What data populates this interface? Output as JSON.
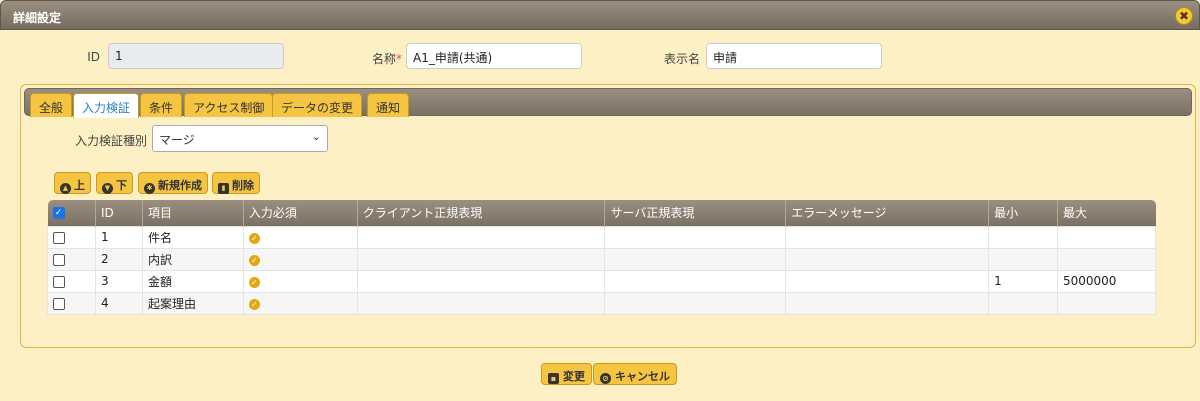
{
  "window": {
    "title": "詳細設定",
    "close_icon": "✖"
  },
  "form": {
    "id_label": "ID",
    "id_value": "1",
    "name_label": "名称",
    "required_mark": "*",
    "name_value": "A1_申請(共通)",
    "display_label": "表示名",
    "display_value": "申請"
  },
  "tabs": [
    {
      "label": "全般"
    },
    {
      "label": "入力検証"
    },
    {
      "label": "条件"
    },
    {
      "label": "アクセス制御"
    },
    {
      "label": "データの変更"
    },
    {
      "label": "通知"
    }
  ],
  "active_tab": "入力検証",
  "validation_type": {
    "label": "入力検証種別",
    "value": "マージ"
  },
  "toolbar": {
    "up_label": "上",
    "down_label": "下",
    "new_label": "新規作成",
    "delete_label": "削除"
  },
  "table": {
    "headers": [
      "",
      "ID",
      "項目",
      "入力必須",
      "クライアント正規表現",
      "サーバ正規表現",
      "エラーメッセージ",
      "最小",
      "最大"
    ],
    "rows": [
      {
        "id": "1",
        "item": "件名",
        "required": true,
        "client_regex": "",
        "server_regex": "",
        "error_message": "",
        "min": "",
        "max": ""
      },
      {
        "id": "2",
        "item": "内訳",
        "required": true,
        "client_regex": "",
        "server_regex": "",
        "error_message": "",
        "min": "",
        "max": ""
      },
      {
        "id": "3",
        "item": "金額",
        "required": true,
        "client_regex": "",
        "server_regex": "",
        "error_message": "",
        "min": "1",
        "max": "5000000"
      },
      {
        "id": "4",
        "item": "起案理由",
        "required": true,
        "client_regex": "",
        "server_regex": "",
        "error_message": "",
        "min": "",
        "max": ""
      }
    ]
  },
  "footer": {
    "change_label": "変更",
    "cancel_label": "キャンセル"
  },
  "colors": {
    "background": "#fdf0c4",
    "accent": "#f5c542",
    "header": "#7a7064",
    "active_tab_text": "#2a7fbf"
  }
}
